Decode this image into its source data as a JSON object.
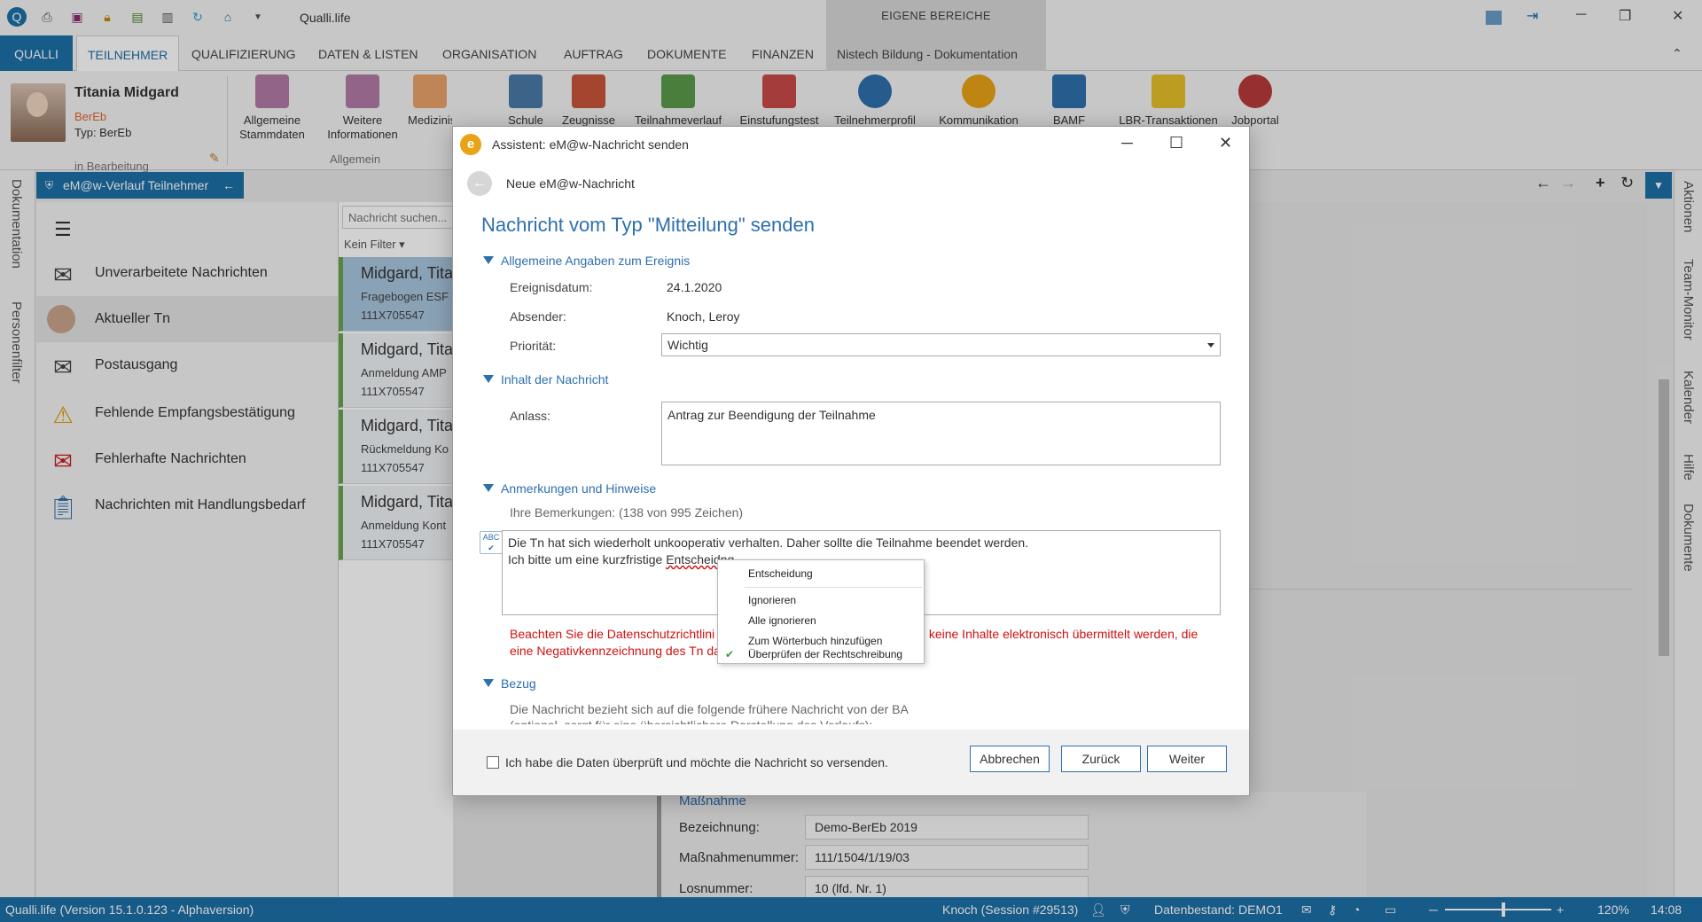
{
  "app": {
    "title": "Qualli.life",
    "eigene_bereiche": "EIGENE BEREICHE"
  },
  "ribbon_tabs": [
    "QUALLI",
    "TEILNEHMER",
    "QUALIFIZIERUNG",
    "DATEN & LISTEN",
    "ORGANISATION",
    "AUFTRAG",
    "DOKUMENTE",
    "FINANZEN",
    "Nistech Bildung - Dokumentation"
  ],
  "person": {
    "name": "Titania Midgard",
    "org": "BerEb",
    "typ": "Typ: BerEb",
    "status": "in Bearbeitung"
  },
  "ribbon_buttons": [
    "Allgemeine Stammdaten",
    "Weitere Informationen",
    "Medizinische Date",
    "Schule",
    "Zeugnisse",
    "Teilnahmeverlauf",
    "Einstufungstest",
    "Teilnehmerprofil",
    "Kommunikation",
    "BAMF",
    "LBR-Transaktionen",
    "Jobportal"
  ],
  "ribbon_group": "Allgemein",
  "side_left": [
    "Dokumentation",
    "Personenfilter"
  ],
  "side_right": [
    "Aktionen",
    "Team-Monitor",
    "Kalender",
    "Hilfe",
    "Dokumente"
  ],
  "panel": {
    "title": "eM@w-Verlauf Teilnehmer"
  },
  "nav": [
    {
      "label": "Unverarbeitete Nachrichten",
      "icon": "envelope-plus-icon"
    },
    {
      "label": "Aktueller Tn",
      "icon": "person-icon"
    },
    {
      "label": "Postausgang",
      "icon": "envelope-out-icon"
    },
    {
      "label": "Fehlende Empfangsbestätigung",
      "icon": "warning-icon"
    },
    {
      "label": "Fehlerhafte Nachrichten",
      "icon": "error-envelope-icon"
    },
    {
      "label": "Nachrichten mit Handlungsbedarf",
      "icon": "clipboard-icon"
    }
  ],
  "msg_search": {
    "placeholder": "Nachricht suchen..."
  },
  "msg_filter": "Kein Filter",
  "messages": [
    {
      "name": "Midgard, Tita",
      "subject": "Fragebogen ESF",
      "id": "111X705547"
    },
    {
      "name": "Midgard, Tita",
      "subject": "Anmeldung AMP",
      "id": "111X705547"
    },
    {
      "name": "Midgard, Tita",
      "subject": "Rückmeldung Ko",
      "id": "111X705547"
    },
    {
      "name": "Midgard, Tita",
      "subject": "Anmeldung Kont",
      "id": "111X705547"
    }
  ],
  "detail": {
    "massnahme_partial": "Maßnahme",
    "bezeichnung_label": "Bezeichnung:",
    "bezeichnung_value": "Demo-BerEb 2019",
    "nummer_label": "Maßnahmenummer:",
    "nummer_value": "111/1504/1/19/03",
    "los_label": "Losnummer:",
    "los_value": "10 (lfd. Nr. 1)"
  },
  "status": {
    "version": "Qualli.life (Version 15.1.0.123 - Alphaversion)",
    "session": "Knoch (Session #29513)",
    "datenbestand": "Datenbestand: DEMO1",
    "zoom": "120%",
    "time": "14:08"
  },
  "dialog": {
    "title": "Assistent: eM@w-Nachricht senden",
    "subtitle": "Neue eM@w-Nachricht",
    "heading": "Nachricht vom Typ \"Mitteilung\" senden",
    "section1": "Allgemeine Angaben zum Ereignis",
    "ereignisdatum_label": "Ereignisdatum:",
    "ereignisdatum": "24.1.2020",
    "absender_label": "Absender:",
    "absender": "Knoch, Leroy",
    "prioritaet_label": "Priorität:",
    "prioritaet": "Wichtig",
    "section2": "Inhalt der Nachricht",
    "anlass_label": "Anlass:",
    "anlass": "Antrag zur Beendigung der Teilnahme",
    "section3": "Anmerkungen und Hinweise",
    "bemerkungen_hint": "Ihre Bemerkungen: (138 von 995 Zeichen)",
    "bemerkung_line1": "Die Tn hat sich wiederholt unkooperativ verhalten. Daher sollte die Teilnahme beendet werden.",
    "bemerkung_line2_pre": "Ich bitte um eine kurzfristige ",
    "bemerkung_line2_word": "Entscheidng",
    "warn_line1": "Beachten Sie die Datenschutzrichtlini",
    "warn_line1_end": "n keine Inhalte elektronisch übermittelt werden, die",
    "warn_line2": "eine Negativkennzeichnung des Tn da",
    "section4": "Bezug",
    "bezug_line1": "Die Nachricht bezieht sich auf die folgende frühere Nachricht von der BA",
    "bezug_line2": "(optional, sorgt für eine übersichtlichere Darstellung des Verlaufs):",
    "confirm_label": "Ich habe die Daten überprüft und möchte die Nachricht so versenden.",
    "btn_cancel": "Abbrechen",
    "btn_back": "Zurück",
    "btn_next": "Weiter"
  },
  "context_menu": {
    "suggestion": "Entscheidung",
    "ignore": "Ignorieren",
    "ignore_all": "Alle ignorieren",
    "add_dict": "Zum Wörterbuch hinzufügen",
    "check": "Überprüfen der Rechtschreibung"
  }
}
